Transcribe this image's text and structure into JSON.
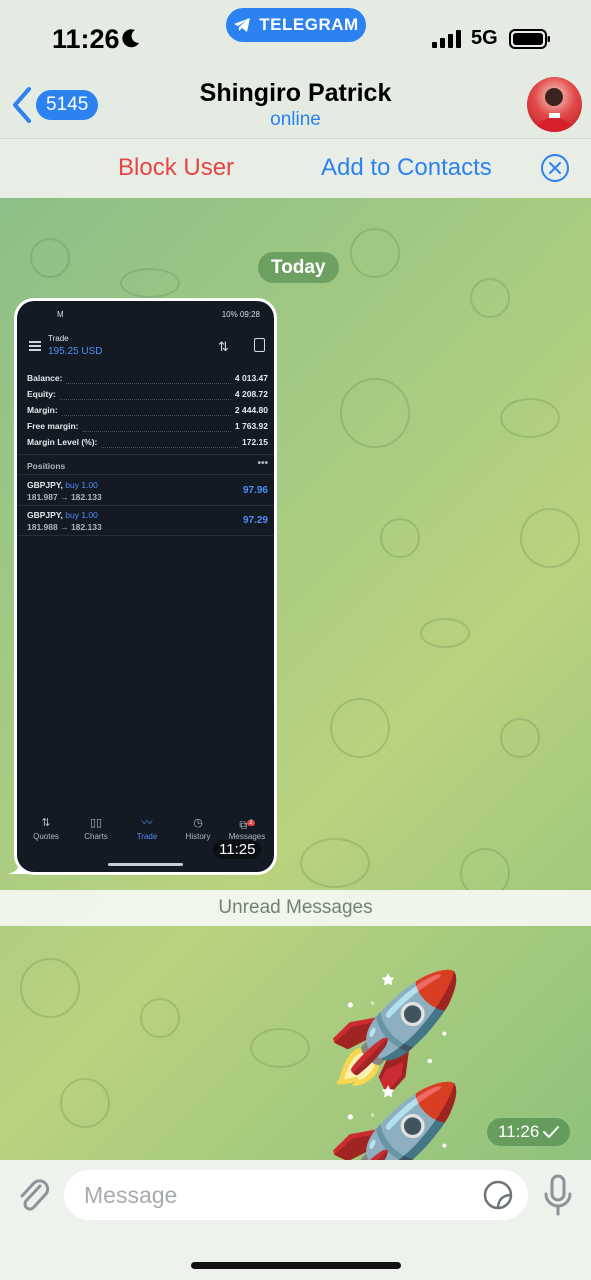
{
  "status_bar": {
    "time": "11:26",
    "app_pill": "TELEGRAM",
    "network": "5G"
  },
  "header": {
    "back_count": "5145",
    "contact_name": "Shingiro Patrick",
    "contact_status": "online"
  },
  "actions": {
    "block": "Block User",
    "add": "Add to Contacts"
  },
  "chat": {
    "date_chip": "Today",
    "photo_time": "11:25",
    "unread_label": "Unread Messages",
    "rocket_time": "11:26",
    "rocket_emoji": "🚀🚀"
  },
  "screenshot": {
    "status_right": "10% 09:28",
    "title": "Trade",
    "balance_header": "195.25 USD",
    "rows": [
      {
        "k": "Balance:",
        "v": "4 013.47"
      },
      {
        "k": "Equity:",
        "v": "4 208.72"
      },
      {
        "k": "Margin:",
        "v": "2 444.80"
      },
      {
        "k": "Free margin:",
        "v": "1 763.92"
      },
      {
        "k": "Margin Level (%):",
        "v": "172.15"
      }
    ],
    "positions_label": "Positions",
    "positions": [
      {
        "symbol": "GBPJPY,",
        "side": "buy 1.00",
        "prices": "181.987 → 182.133",
        "pl": "97.96"
      },
      {
        "symbol": "GBPJPY,",
        "side": "buy 1.00",
        "prices": "181.988 → 182.133",
        "pl": "97.29"
      }
    ],
    "nav": [
      "Quotes",
      "Charts",
      "Trade",
      "History",
      "Messages"
    ],
    "nav_badge": "2"
  },
  "composer": {
    "placeholder": "Message"
  },
  "colors": {
    "accent": "#2b82f0",
    "danger": "#e54545",
    "trade_blue": "#4f8ef5"
  }
}
